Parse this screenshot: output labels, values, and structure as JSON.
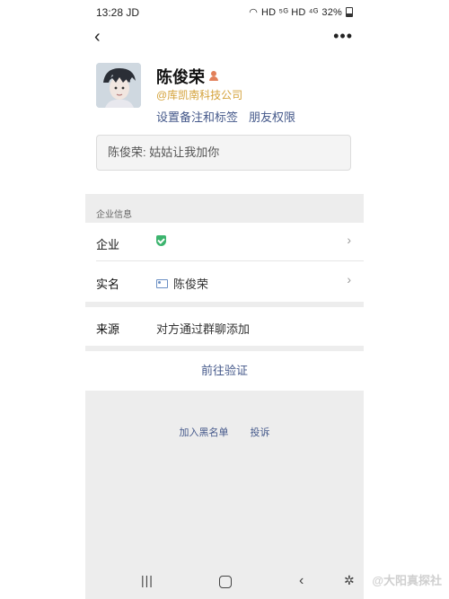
{
  "status_bar": {
    "time": "13:28 JD",
    "indicators": "HD ⁵ᴳ HD ⁴ᴳ",
    "battery": "32%"
  },
  "nav": {
    "back_icon": "‹",
    "more_icon": "•••"
  },
  "profile": {
    "name": "陈俊荣",
    "company": "@库凯南科技公司",
    "links": {
      "remark": "设置备注和标签",
      "permissions": "朋友权限"
    }
  },
  "greeting": "陈俊荣: 姑姑让我加你",
  "enterprise": {
    "section_title": "企业信息",
    "rows": [
      {
        "label": "企业",
        "value": "",
        "icon": "verified-shield-icon"
      },
      {
        "label": "实名",
        "value": "陈俊荣",
        "icon": "id-card-icon"
      }
    ]
  },
  "source": {
    "label": "来源",
    "value": "对方通过群聊添加"
  },
  "verify_button": "前往验证",
  "bottom_links": {
    "blacklist": "加入黑名单",
    "report": "投诉"
  },
  "watermark": "@大阳真探社",
  "colors": {
    "link": "#44588a",
    "company": "#d4a23a",
    "verified": "#3cb46e",
    "background": "#ededed"
  }
}
